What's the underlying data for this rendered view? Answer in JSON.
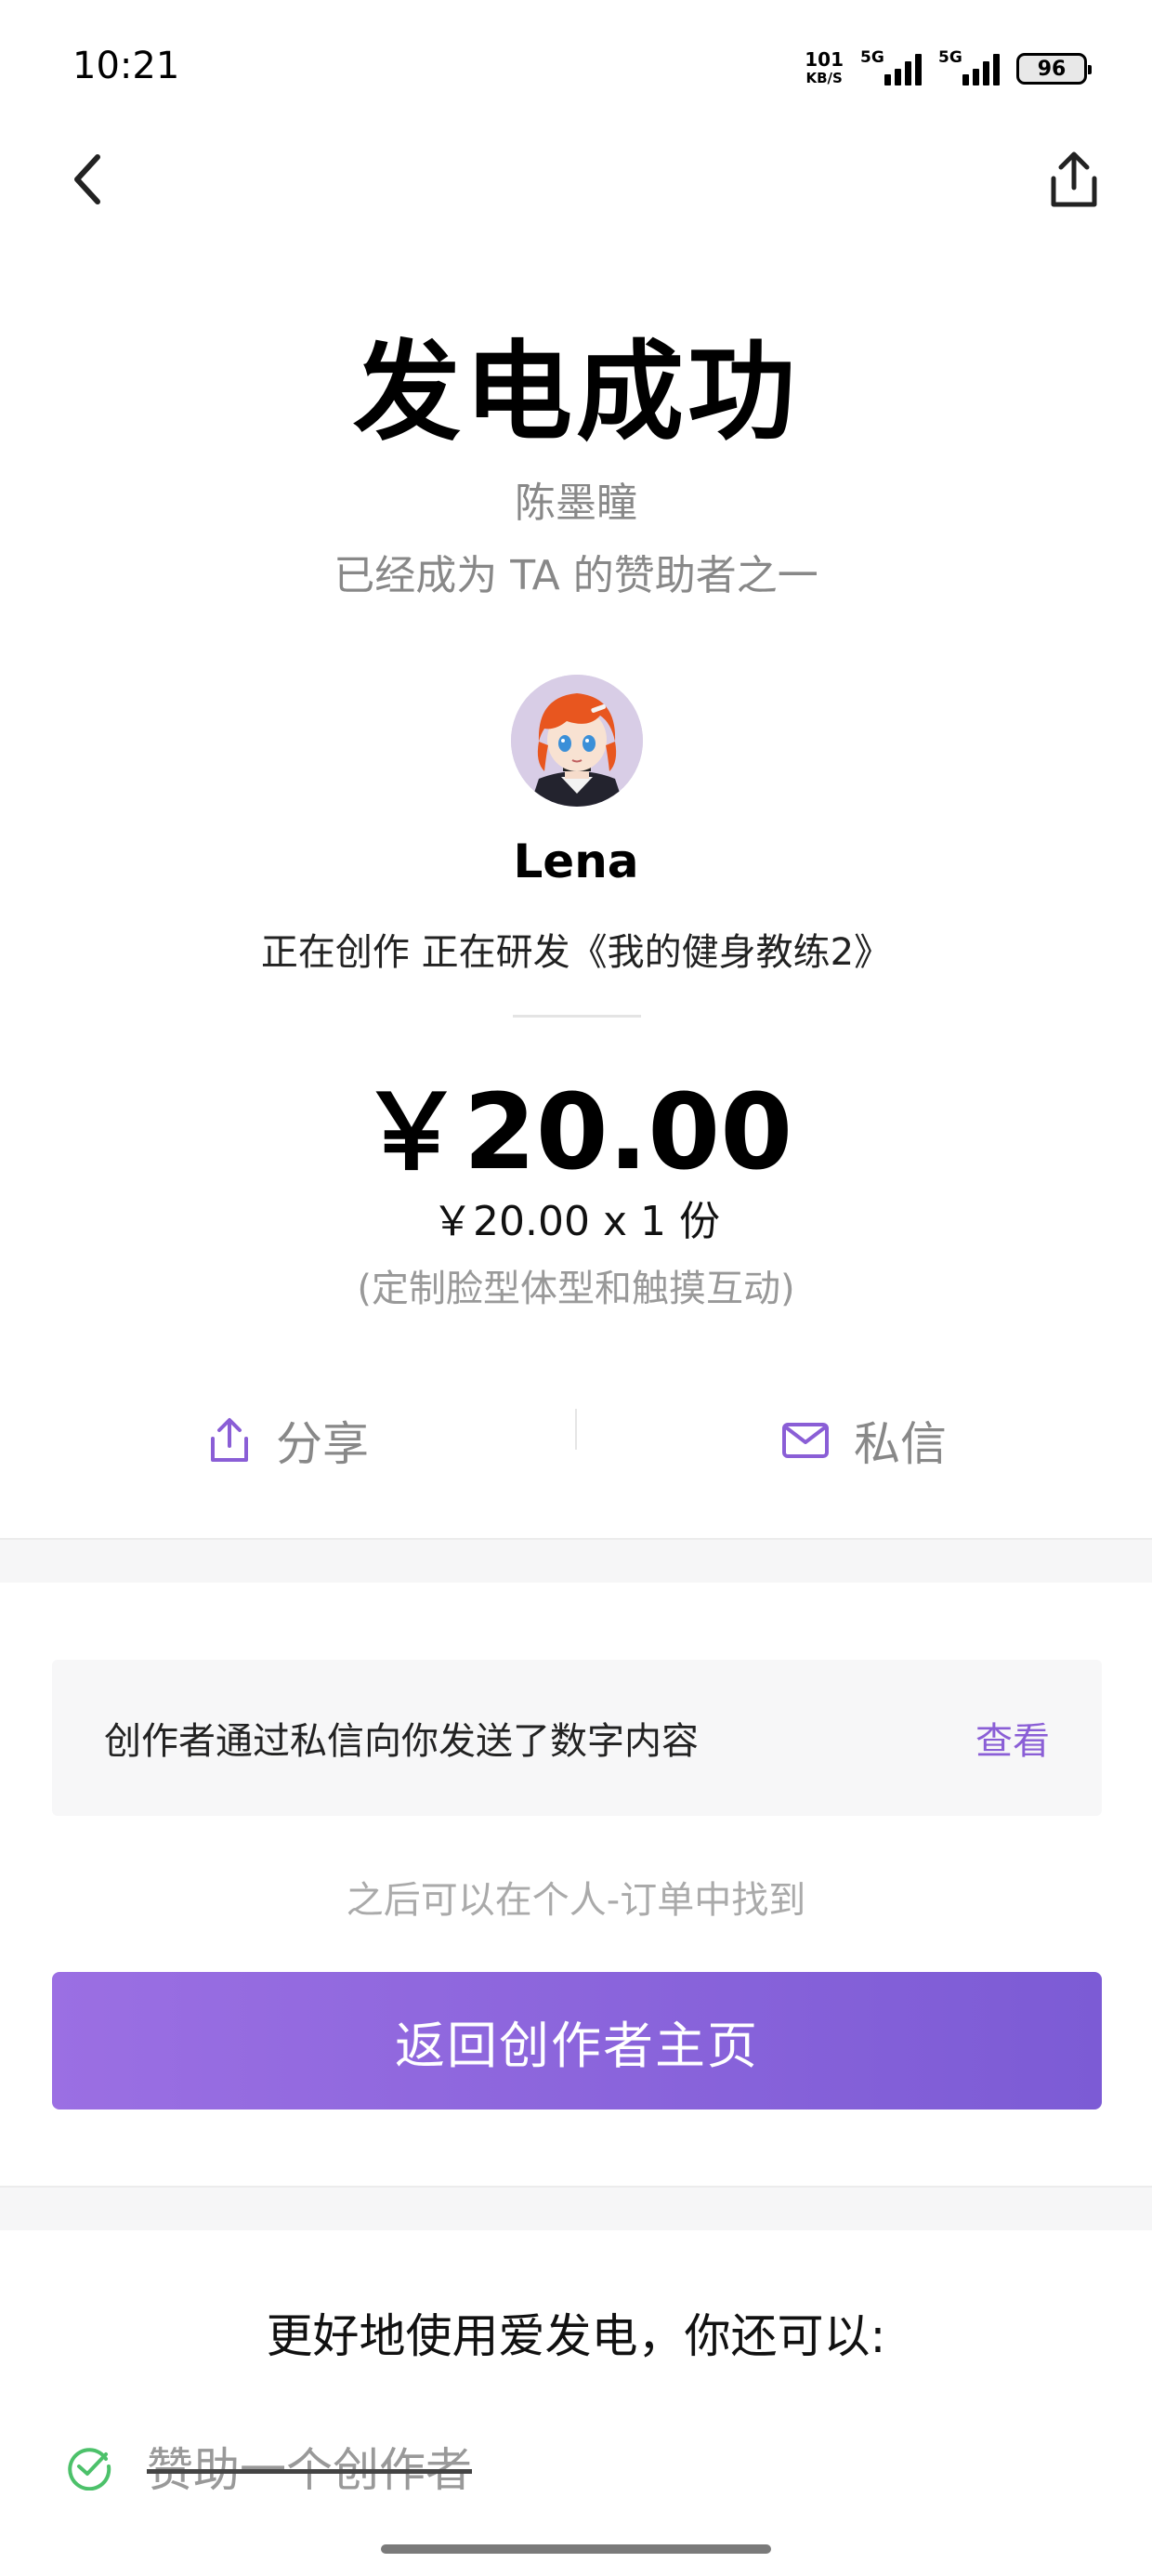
{
  "status_bar": {
    "time": "10:21",
    "net_speed_value": "101",
    "net_speed_unit": "KB/S",
    "signal_1_tag": "5G",
    "signal_2_tag": "5G",
    "battery": "96"
  },
  "nav": {
    "back_icon": "chevron-left-icon",
    "share_icon": "share-upload-icon"
  },
  "hero": {
    "title": "发电成功",
    "creator_sub": "陈墨瞳",
    "sponsor_line": "已经成为 TA 的赞助者之一"
  },
  "creator": {
    "name": "Lena",
    "bio": "正在创作 正在研发《我的健身教练2》"
  },
  "payment": {
    "amount": "￥20.00",
    "detail": "￥20.00 x 1 份",
    "option_note": "(定制脸型体型和触摸互动)"
  },
  "actions": {
    "share_label": "分享",
    "message_label": "私信"
  },
  "notice": {
    "text": "创作者通过私信向你发送了数字内容",
    "link": "查看"
  },
  "find_hint": "之后可以在个人-订单中找到",
  "primary_button": "返回创作者主页",
  "tips": {
    "title": "更好地使用爱发电，你还可以:",
    "items": [
      {
        "label": "赞助一个创作者",
        "done": true
      }
    ]
  },
  "colors": {
    "accent": "#8a5ed6",
    "button_start": "#9b6fe3",
    "button_end": "#7c5bd5",
    "check_green": "#4cc16a"
  }
}
